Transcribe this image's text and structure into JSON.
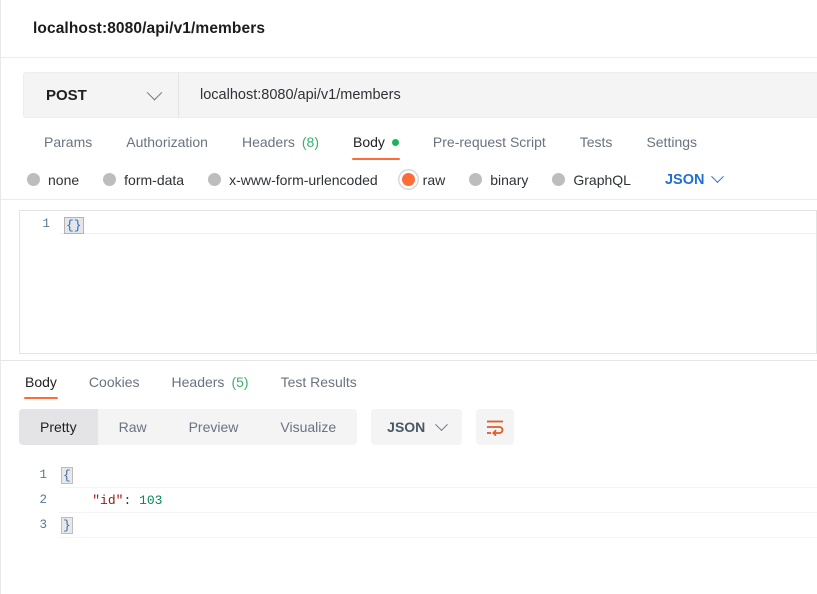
{
  "header": {
    "title": "localhost:8080/api/v1/members"
  },
  "request": {
    "method": "POST",
    "method_icon": "chevron-down-icon",
    "url": "localhost:8080/api/v1/members",
    "tabs": [
      {
        "label": "Params",
        "active": false,
        "count": "",
        "dot": false
      },
      {
        "label": "Authorization",
        "active": false,
        "count": "",
        "dot": false
      },
      {
        "label": "Headers",
        "active": false,
        "count": "(8)",
        "dot": false
      },
      {
        "label": "Body",
        "active": true,
        "count": "",
        "dot": true
      },
      {
        "label": "Pre-request Script",
        "active": false,
        "count": "",
        "dot": false
      },
      {
        "label": "Tests",
        "active": false,
        "count": "",
        "dot": false
      },
      {
        "label": "Settings",
        "active": false,
        "count": "",
        "dot": false
      }
    ],
    "body_types": [
      {
        "label": "none",
        "selected": false
      },
      {
        "label": "form-data",
        "selected": false
      },
      {
        "label": "x-www-form-urlencoded",
        "selected": false
      },
      {
        "label": "raw",
        "selected": true
      },
      {
        "label": "binary",
        "selected": false
      },
      {
        "label": "GraphQL",
        "selected": false
      }
    ],
    "format_select": {
      "label": "JSON",
      "icon": "chevron-down-icon"
    },
    "editor": {
      "lines": [
        {
          "number": "1",
          "text": "{}"
        }
      ]
    }
  },
  "response": {
    "tabs": [
      {
        "label": "Body",
        "active": true,
        "count": ""
      },
      {
        "label": "Cookies",
        "active": false,
        "count": ""
      },
      {
        "label": "Headers",
        "active": false,
        "count": "(5)"
      },
      {
        "label": "Test Results",
        "active": false,
        "count": ""
      }
    ],
    "view_modes": [
      {
        "label": "Pretty",
        "active": true
      },
      {
        "label": "Raw",
        "active": false
      },
      {
        "label": "Preview",
        "active": false
      },
      {
        "label": "Visualize",
        "active": false
      }
    ],
    "format_select": {
      "label": "JSON",
      "icon": "chevron-down-icon"
    },
    "wrap_button_icon": "wrap-text-icon",
    "body": {
      "lines": [
        {
          "number": "1",
          "open_brace": "{",
          "key": "",
          "colon": "",
          "value": "",
          "close_brace": ""
        },
        {
          "number": "2",
          "open_brace": "",
          "key": "\"id\"",
          "colon": ":",
          "value": "103",
          "close_brace": ""
        },
        {
          "number": "3",
          "open_brace": "",
          "key": "",
          "colon": "",
          "value": "",
          "close_brace": "}"
        }
      ]
    }
  },
  "colors": {
    "accent": "#ff6c37",
    "green": "#17b65a",
    "count_green": "#3eae6d",
    "link_blue": "#1f6fd4",
    "json_key": "#a31515",
    "json_number": "#098658"
  }
}
